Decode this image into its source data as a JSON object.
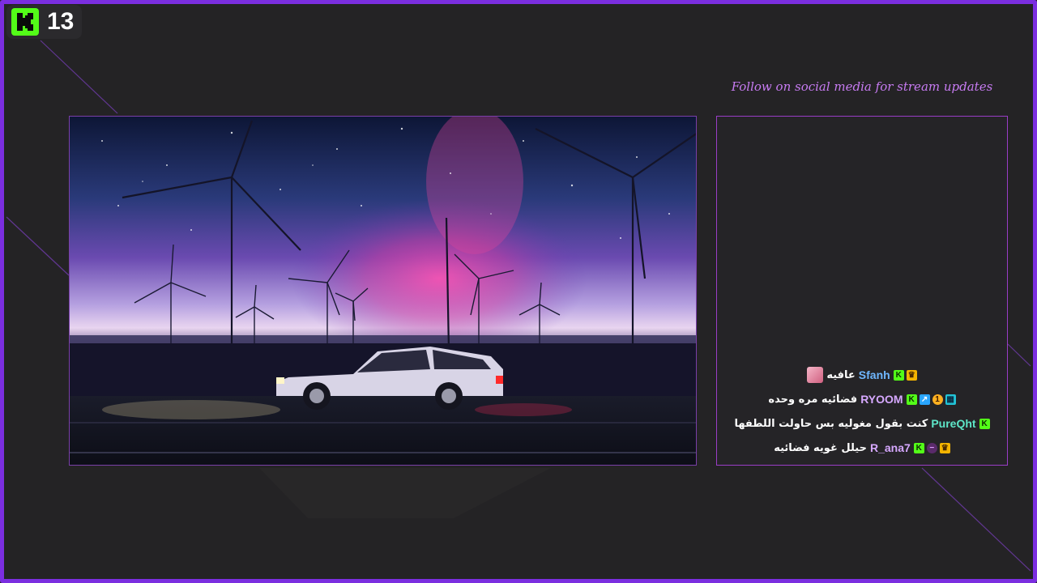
{
  "viewer_badge": {
    "count": "13"
  },
  "follow_text": "Follow on social media for stream updates",
  "chat": {
    "messages": [
      {
        "username": "Sfanh",
        "text": "عافيه",
        "color": "#6fb7ff",
        "badges": [
          "crown",
          "kick"
        ],
        "has_avatar": true
      },
      {
        "username": "RYOOM",
        "text": "فضائيه مره وحده",
        "color": "#d6a8ff",
        "badges": [
          "grid",
          "one",
          "prime",
          "kick"
        ],
        "has_avatar": false
      },
      {
        "username": "PureQht",
        "text": "كنت بقول مغوليه بس حاولت اللطفها",
        "color": "#5ee6c8",
        "badges": [
          "kick"
        ],
        "has_avatar": false
      },
      {
        "username": "R_ana7",
        "text": "حيلل غويه فضائيه",
        "color": "#d6a8ff",
        "badges": [
          "crown",
          "minus",
          "kick"
        ],
        "has_avatar": false
      }
    ]
  },
  "colors": {
    "frame_border": "#7b2ee0",
    "kick_green": "#53fc18",
    "accent_purple": "#c77bf2"
  }
}
